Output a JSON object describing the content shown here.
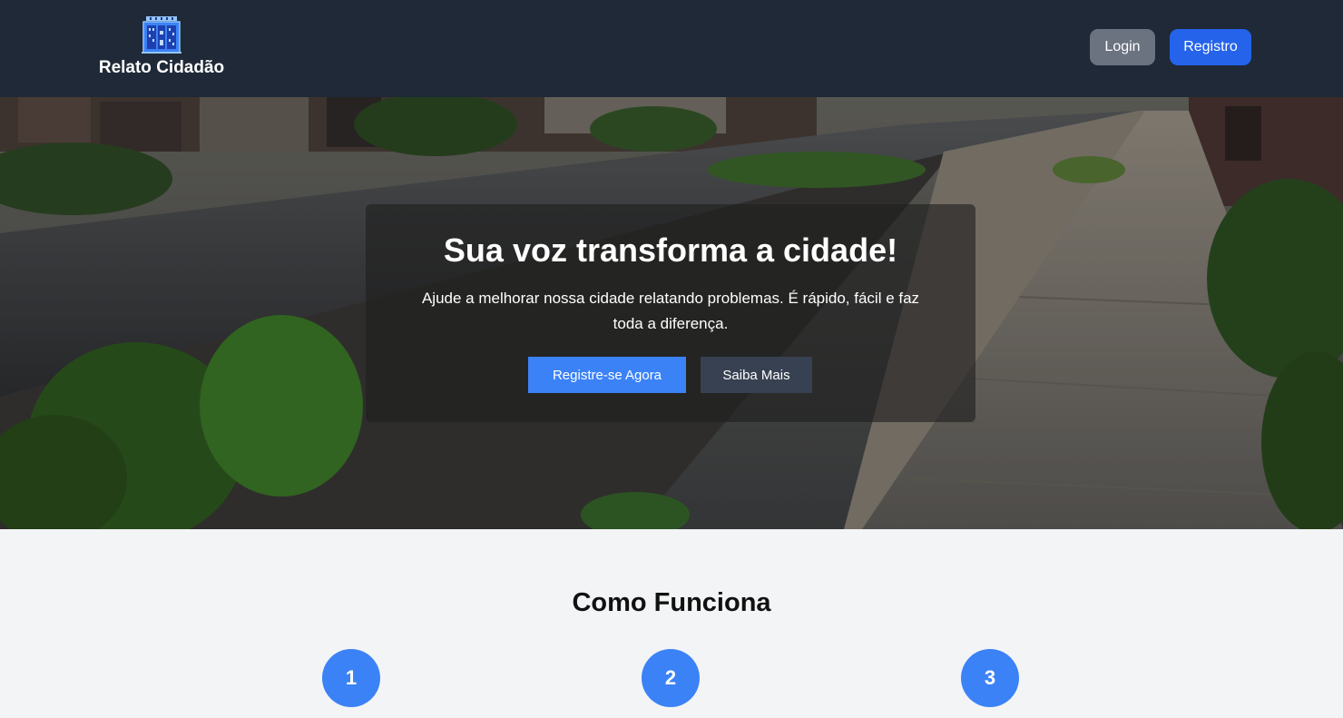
{
  "header": {
    "brand_name": "Relato Cidadão",
    "logo_icon": "city-building-icon",
    "login_label": "Login",
    "register_label": "Registro",
    "colors": {
      "background": "#1f2937",
      "login_button": "#6b7280",
      "register_button": "#2563eb"
    }
  },
  "hero": {
    "title": "Sua voz transforma a cidade!",
    "description": "Ajude a melhorar nossa cidade relatando problemas. É rápido, fácil e faz toda a diferença.",
    "cta_label": "Registre-se Agora",
    "more_label": "Saiba Mais",
    "background_image": "abandoned-street-photo",
    "colors": {
      "cta_button": "#3b82f6",
      "more_button": "#374151"
    }
  },
  "how_it_works": {
    "title": "Como Funciona",
    "steps": [
      "1",
      "2",
      "3"
    ],
    "step_color": "#3b82f6"
  }
}
